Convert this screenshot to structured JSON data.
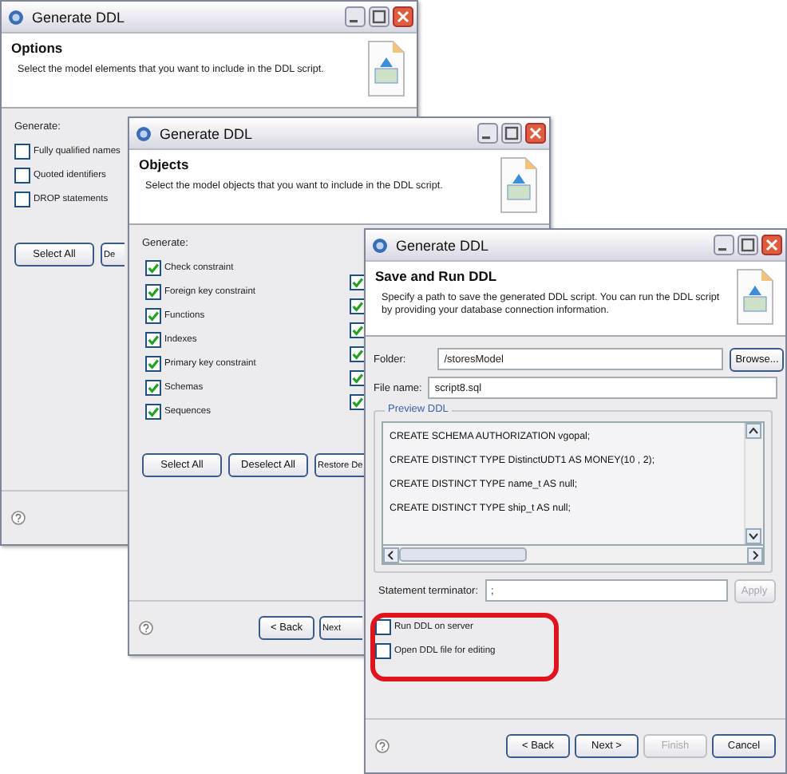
{
  "windows": [
    {
      "title": "Generate DDL",
      "heading": "Options",
      "description": "Select the model elements that you want to include in the DDL script.",
      "generate_label": "Generate:",
      "options": [
        {
          "label": "Fully qualified names",
          "checked": false
        },
        {
          "label": "Quoted identifiers",
          "checked": false
        },
        {
          "label": "DROP statements",
          "checked": false
        }
      ],
      "buttons": [
        "Select All",
        "De"
      ]
    },
    {
      "title": "Generate DDL",
      "heading": "Objects",
      "description": "Select the model objects that you want to include in the DDL script.",
      "generate_label": "Generate:",
      "options": [
        {
          "label": "Check constraint",
          "checked": true
        },
        {
          "label": "Foreign key constraint",
          "checked": true
        },
        {
          "label": "Functions",
          "checked": true
        },
        {
          "label": "Indexes",
          "checked": true
        },
        {
          "label": "Primary key constraint",
          "checked": true
        },
        {
          "label": "Schemas",
          "checked": true
        },
        {
          "label": "Sequences",
          "checked": true
        }
      ],
      "options_column_2": [
        {
          "checked": true
        },
        {
          "checked": true
        },
        {
          "checked": true
        },
        {
          "checked": true
        },
        {
          "checked": true
        },
        {
          "checked": true
        }
      ],
      "buttons": [
        "Select All",
        "Deselect All",
        "Restore De"
      ],
      "nav_buttons": [
        {
          "label": "< Back",
          "disabled": false
        },
        {
          "label": "Next",
          "disabled": false
        }
      ]
    },
    {
      "title": "Generate DDL",
      "heading": "Save and Run DDL",
      "description": "Specify a path to save the generated DDL script. You can run the DDL script by providing your database connection information.",
      "folder": {
        "label": "Folder:",
        "value": "/storesModel",
        "button": "Browse..."
      },
      "file_name": {
        "label": "File name:",
        "value": "script8.sql"
      },
      "preview": {
        "label": "Preview DDL",
        "lines": [
          "CREATE SCHEMA AUTHORIZATION vgopal;",
          "CREATE DISTINCT TYPE DistinctUDT1 AS MONEY(10 , 2);",
          "CREATE DISTINCT TYPE name_t AS null;",
          "CREATE DISTINCT TYPE ship_t AS null;"
        ]
      },
      "terminator": {
        "label": "Statement terminator:",
        "value": ";",
        "button": "Apply",
        "button_disabled": true
      },
      "options": [
        {
          "label": "Run DDL on server",
          "checked": false
        },
        {
          "label": "Open DDL file for editing",
          "checked": false
        }
      ],
      "nav_buttons": [
        {
          "label": "< Back",
          "disabled": false
        },
        {
          "label": "Next >",
          "disabled": false
        },
        {
          "label": "Finish",
          "disabled": true
        },
        {
          "label": "Cancel",
          "disabled": false
        }
      ]
    }
  ]
}
